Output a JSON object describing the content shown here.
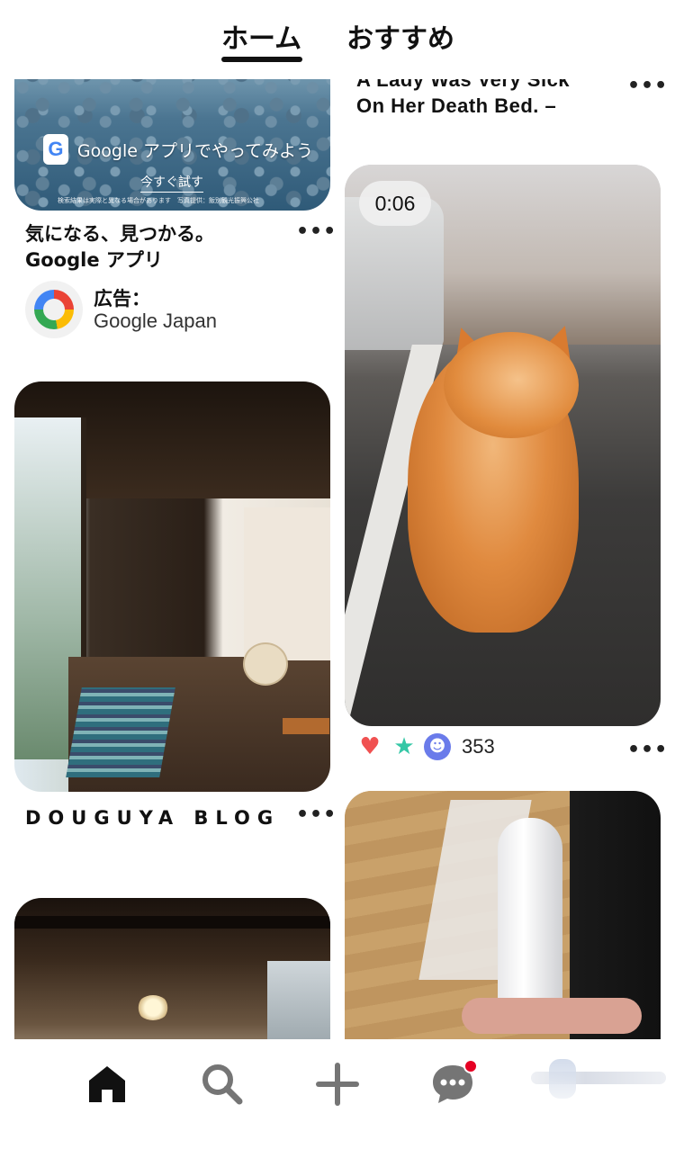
{
  "top_tabs": {
    "home": "ホーム",
    "recommended": "おすすめ",
    "active": "home"
  },
  "feed": {
    "left_column": {
      "ad_pin": {
        "image_overlay": {
          "app_text": "Google アプリでやってみよう",
          "cta": "今すぐ試す",
          "fine_print": "検索結果は実際と異なる場合があります　写真提供：飯別観光振興公社"
        },
        "title": "気になる、見つかる。Google アプリ",
        "advertiser_label": "広告：",
        "advertiser_name": "Google Japan",
        "more": "•••"
      },
      "pin_douguya": {
        "title": "DOUGUYA BLOG",
        "more": "•••"
      }
    },
    "right_column": {
      "pin_text": {
        "title": "A Lady Was Very Sick On Her Death Bed. –",
        "more": "•••"
      },
      "pin_cat_video": {
        "duration": "0:06",
        "reaction_count": "353",
        "more": "•••"
      }
    }
  },
  "bottom_nav": {
    "items": [
      "home-icon",
      "search-icon",
      "add-icon",
      "messages-icon",
      "profile"
    ],
    "active": "home",
    "has_notification": true,
    "accent_color": "#e60023"
  }
}
